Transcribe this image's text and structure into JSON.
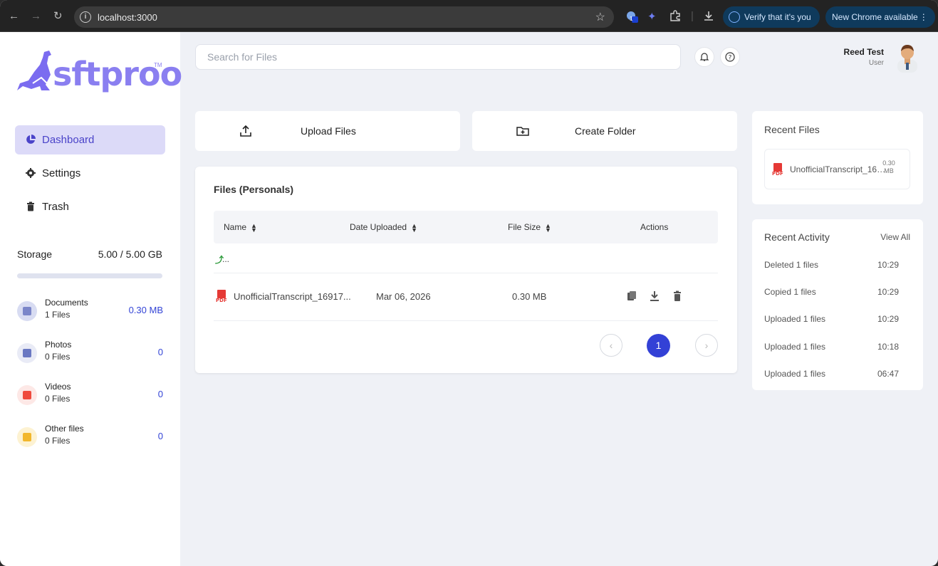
{
  "browser": {
    "url": "localhost:3000",
    "verify_label": "Verify that it's you",
    "update_label": "New Chrome available",
    "ext_badge": "1"
  },
  "logo": {
    "text": "sftproo",
    "tm": "TM"
  },
  "sidebar": {
    "items": [
      {
        "label": "Dashboard",
        "icon": "pie-chart-icon",
        "active": true
      },
      {
        "label": "Settings",
        "icon": "gear-icon",
        "active": false
      },
      {
        "label": "Trash",
        "icon": "trash-icon",
        "active": false
      }
    ],
    "storage": {
      "label": "Storage",
      "value": "5.00 / 5.00 GB"
    },
    "categories": [
      {
        "name": "Documents",
        "count": "1 Files",
        "size": "0.30 MB",
        "color": "#d8dcf2",
        "icon_color": "#7b86c9"
      },
      {
        "name": "Photos",
        "count": "0 Files",
        "size": "0",
        "color": "#e9ebf6",
        "icon_color": "#6a78c2"
      },
      {
        "name": "Videos",
        "count": "0 Files",
        "size": "0",
        "color": "#fde8e6",
        "icon_color": "#ef4b3e"
      },
      {
        "name": "Other files",
        "count": "0 Files",
        "size": "0",
        "color": "#fdf2d2",
        "icon_color": "#f2b72c"
      }
    ]
  },
  "header": {
    "search_placeholder": "Search for Files",
    "user_name": "Reed Test",
    "user_role": "User"
  },
  "actions": {
    "upload": "Upload Files",
    "create_folder": "Create Folder"
  },
  "files": {
    "title": "Files (Personals)",
    "columns": {
      "name": "Name",
      "date": "Date Uploaded",
      "size": "File Size",
      "actions": "Actions"
    },
    "up_label": "...",
    "rows": [
      {
        "name": "UnofficialTranscript_16917...",
        "date": "Mar 06, 2026",
        "size": "0.30 MB",
        "type": "PDF"
      }
    ],
    "page": "1"
  },
  "recent_files": {
    "title": "Recent Files",
    "items": [
      {
        "name": "UnofficialTranscript_1691745...",
        "size": "0.30 MB",
        "type": "PDF"
      }
    ]
  },
  "recent_activity": {
    "title": "Recent Activity",
    "view_all": "View All",
    "items": [
      {
        "text": "Deleted 1 files",
        "time": "10:29"
      },
      {
        "text": "Copied 1 files",
        "time": "10:29"
      },
      {
        "text": "Uploaded 1 files",
        "time": "10:29"
      },
      {
        "text": "Uploaded 1 files",
        "time": "10:18"
      },
      {
        "text": "Uploaded 1 files",
        "time": "06:47"
      }
    ]
  },
  "colors": {
    "accent": "#3341d6",
    "brand": "#8a7ff0",
    "active_bg": "#dcdaf8"
  }
}
